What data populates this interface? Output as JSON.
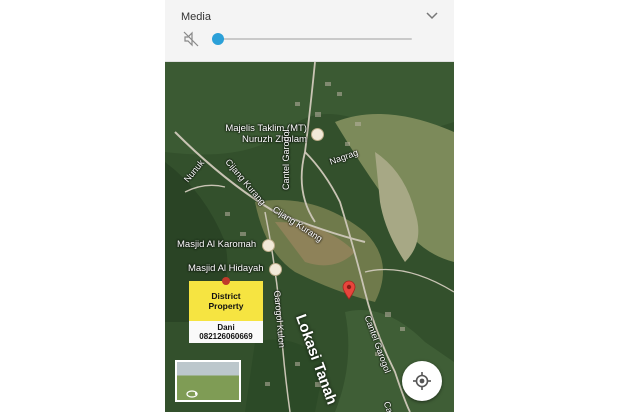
{
  "media": {
    "title": "Media",
    "volume_level": 0.03,
    "accent_color": "#2ba0d8",
    "icons": {
      "mute": "volume-mute-icon",
      "collapse": "chevron-down-icon"
    }
  },
  "map": {
    "labels": {
      "majelis_line1": "Majelis Taklim (MT)",
      "majelis_line2": "Nuruzh Zhulam",
      "nagrag": "Nagrag",
      "nunuk": "Nunuk",
      "cijang_kurang_1": "Cijang Kurang",
      "cijang_kurang_2": "Cijang Kurang",
      "cantel_garogol_1": "Cantel Garogol",
      "cantel_garogol_2": "Cantel Garogol",
      "garogol_kulon": "Garogol Kulon",
      "masjid_karomah": "Masjid Al Karomah",
      "masjid_hidayah": "Masjid Al Hidayah",
      "lokasi": "Lokasi Tanah"
    },
    "sign": {
      "line1": "District",
      "line2": "Property",
      "contact_name": "Dani",
      "contact_phone": "082126060669"
    },
    "icons": {
      "mosque": "mosque-icon",
      "pin": "location-pin-icon",
      "locate": "my-location-icon",
      "streetview": "street-view-icon"
    },
    "pin_color": "#e8453c"
  }
}
